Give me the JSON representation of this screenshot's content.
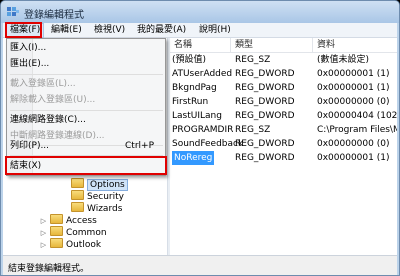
{
  "window": {
    "title": "登錄編輯程式"
  },
  "menubar": {
    "items": [
      {
        "label": "檔案(F)"
      },
      {
        "label": "編輯(E)"
      },
      {
        "label": "檢視(V)"
      },
      {
        "label": "我的最愛(A)"
      },
      {
        "label": "說明(H)"
      }
    ]
  },
  "file_menu": {
    "import": "匯入(I)...",
    "export": "匯出(E)...",
    "load_hive": "載入登錄區(L)...",
    "unload_hive": "解除載入登錄區(U)...",
    "connect_network": "連線網路登錄(C)...",
    "disconnect_network": "中斷網路登錄連線(D)...",
    "print": "列印(P)...",
    "print_shortcut": "Ctrl+P",
    "exit": "結束(X)"
  },
  "list": {
    "columns": [
      "名稱",
      "類型",
      "資料"
    ],
    "rows": [
      {
        "name": "(預設值)",
        "type": "REG_SZ",
        "data": "(數值未設定)"
      },
      {
        "name": "ATUserAdded",
        "type": "REG_DWORD",
        "data": "0x00000001 (1)"
      },
      {
        "name": "BkgndPag",
        "type": "REG_DWORD",
        "data": "0x00000001 (1)"
      },
      {
        "name": "FirstRun",
        "type": "REG_DWORD",
        "data": "0x00000000 (0)"
      },
      {
        "name": "LastUILang",
        "type": "REG_DWORD",
        "data": "0x00000404 (1028)"
      },
      {
        "name": "PROGRAMDIR",
        "type": "REG_SZ",
        "data": "C:\\Program Files\\Micro"
      },
      {
        "name": "SoundFeedback",
        "type": "REG_DWORD",
        "data": "0x00000000 (0)"
      },
      {
        "name": "NoRereg",
        "type": "REG_DWORD",
        "data": "0x00000001 (1)"
      }
    ]
  },
  "tree": {
    "items": [
      {
        "label": "Options"
      },
      {
        "label": "Security"
      },
      {
        "label": "Wizards"
      },
      {
        "label": "Access"
      },
      {
        "label": "Common"
      },
      {
        "label": "Outlook"
      }
    ]
  },
  "statusbar": {
    "text": "結束登錄編輯程式。"
  },
  "colors": {
    "highlight_box": "#e00000",
    "selection": "#3399ff"
  }
}
